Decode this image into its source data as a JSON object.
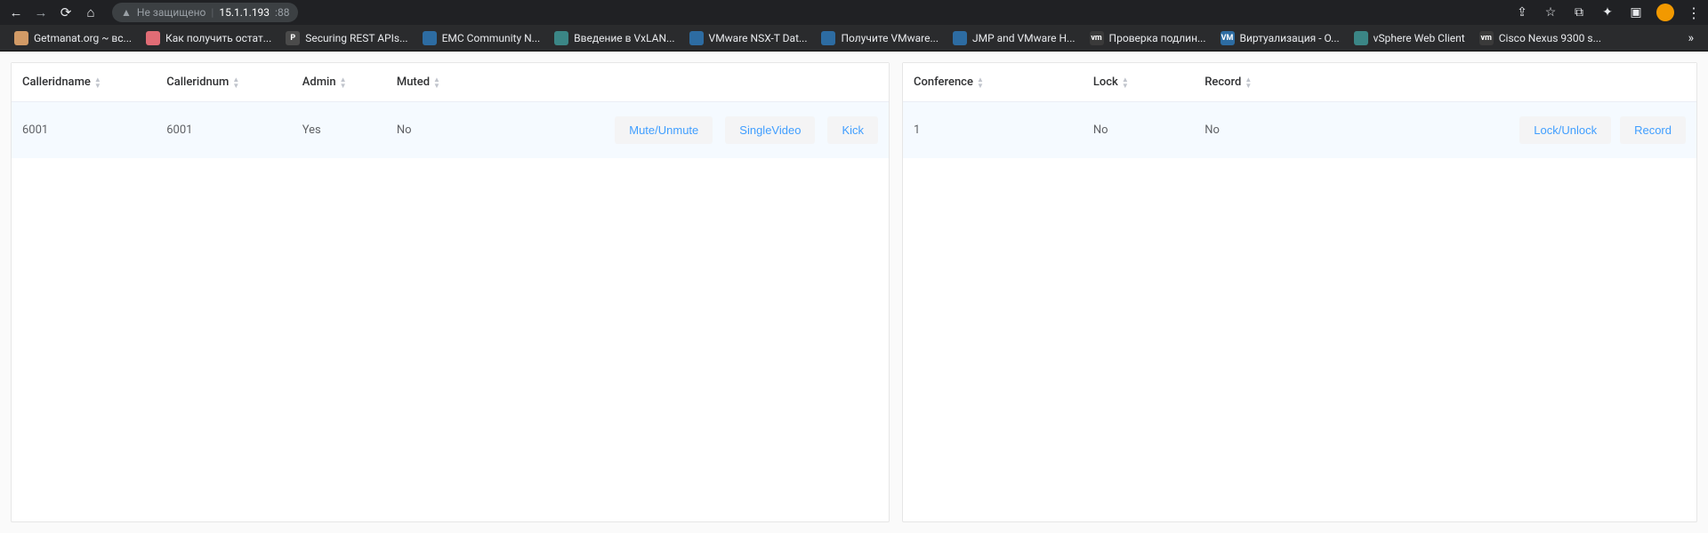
{
  "browser": {
    "security_label": "Не защищено",
    "host": "15.1.1.193",
    "port": ":88"
  },
  "bookmarks": [
    {
      "label": "Getmanat.org ~ вс...",
      "color": "#d19a66"
    },
    {
      "label": "Как получить остат...",
      "color": "#e06c75"
    },
    {
      "label": "Securing REST APIs...",
      "color": "#4b4b4b"
    },
    {
      "label": "EMC Community N...",
      "color": "#2d6ca2"
    },
    {
      "label": "Введение в VxLAN...",
      "color": "#3b8686"
    },
    {
      "label": "VMware NSX-T Dat...",
      "color": "#2d6ca2"
    },
    {
      "label": "Получите VMware...",
      "color": "#2d6ca2"
    },
    {
      "label": "JMP and VMware H...",
      "color": "#2d6ca2"
    },
    {
      "label": "Проверка подлин...",
      "color": "#3a3a3a"
    },
    {
      "label": "Виртуализация - О...",
      "color": "#2d6ca2"
    },
    {
      "label": "vSphere Web Client",
      "color": "#3b8686"
    },
    {
      "label": "Cisco Nexus 9300 s...",
      "color": "#3a3a3a"
    }
  ],
  "callers": {
    "headers": {
      "name": "Calleridname",
      "num": "Calleridnum",
      "admin": "Admin",
      "muted": "Muted"
    },
    "rows": [
      {
        "name": "6001",
        "num": "6001",
        "admin": "Yes",
        "muted": "No"
      }
    ],
    "actions": {
      "mute": "Mute/Unmute",
      "single": "SingleVideo",
      "kick": "Kick"
    }
  },
  "conference": {
    "headers": {
      "conf": "Conference",
      "lock": "Lock",
      "record": "Record"
    },
    "rows": [
      {
        "conf": "1",
        "lock": "No",
        "record": "No"
      }
    ],
    "actions": {
      "lock": "Lock/Unlock",
      "record": "Record"
    }
  }
}
